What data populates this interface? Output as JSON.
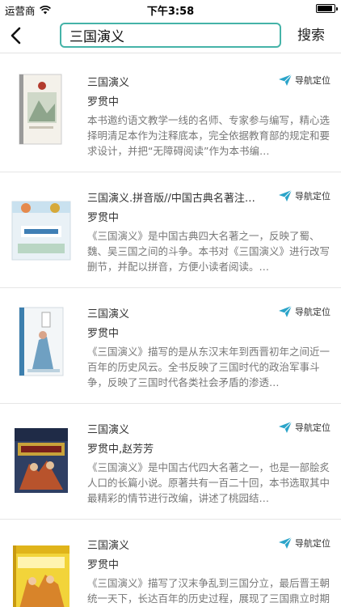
{
  "status_bar": {
    "carrier": "运营商",
    "time": "下午3:58",
    "battery_level_percent": 90
  },
  "nav": {
    "search_value": "三国演义",
    "search_button_label": "搜索"
  },
  "results": [
    {
      "title": "三国演义",
      "author": "罗贯中",
      "description": "本书邀约语文教学一线的名师、专家参与编写，精心选择明清足本作为注释底本，完全依据教育部的规定和要求设计，并把“无障碍阅读”作为本书编…",
      "nav_label": "导航定位"
    },
    {
      "title": "三国演义.拼音版//中国古典名著注…",
      "author": "罗贯中",
      "description": "《三国演义》是中国古典四大名著之一，反映了蜀、魏、吴三国之间的斗争。本书对《三国演义》进行改写删节，并配以拼音，方便小读者阅读。…",
      "nav_label": "导航定位"
    },
    {
      "title": "三国演义",
      "author": "罗贯中",
      "description": "《三国演义》描写的是从东汉末年到西晋初年之间近一百年的历史风云。全书反映了三国时代的政治军事斗争，反映了三国时代各类社会矛盾的渗透…",
      "nav_label": "导航定位"
    },
    {
      "title": "三国演义",
      "author": "罗贯中,赵芳芳",
      "description": "《三国演义》是中国古代四大名著之一，也是一部脍炙人口的长篇小说。原著共有一百二十回，本书选取其中最精彩的情节进行改编，讲述了桃园结…",
      "nav_label": "导航定位"
    },
    {
      "title": "三国演义",
      "author": "罗贯中",
      "description": "《三国演义》描写了汉末争乱到三国分立，最后晋王朝统一天下，长达百年的历史过程，展现了三国鼎立时期各封建统治集团之间政治、军事、外交…",
      "nav_label": "导航定位"
    }
  ],
  "colors": {
    "accent": "#45b3a8",
    "nav_icon": "#2aa4c9"
  },
  "icons": {
    "back": "chevron-left-icon",
    "nav": "paper-plane-icon"
  }
}
